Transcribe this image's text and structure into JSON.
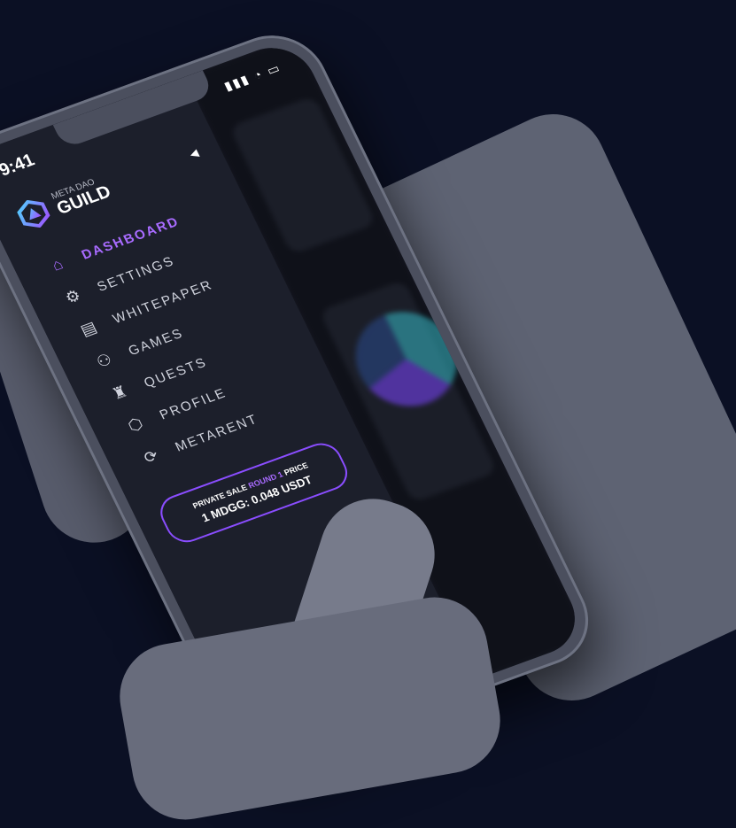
{
  "status_bar": {
    "time": "9:41"
  },
  "brand": {
    "line1": "META DAO",
    "line2": "GUILD"
  },
  "menu": [
    {
      "label": "DASHBOARD",
      "icon": "home-icon",
      "active": true
    },
    {
      "label": "SETTINGS",
      "icon": "gear-icon",
      "active": false
    },
    {
      "label": "WHITEPAPER",
      "icon": "document-icon",
      "active": false
    },
    {
      "label": "GAMES",
      "icon": "gamepad-icon",
      "active": false
    },
    {
      "label": "QUESTS",
      "icon": "quest-icon",
      "active": false
    },
    {
      "label": "PROFILE",
      "icon": "profile-icon",
      "active": false
    },
    {
      "label": "METARENT",
      "icon": "rent-icon",
      "active": false
    }
  ],
  "sale": {
    "prefix": "PRIVATE SALE",
    "round": "ROUND 1",
    "suffix": "PRICE",
    "price": "1 MDGG: 0.048 USDT"
  },
  "colors": {
    "accent": "#a86bff",
    "background": "#0b1024"
  }
}
